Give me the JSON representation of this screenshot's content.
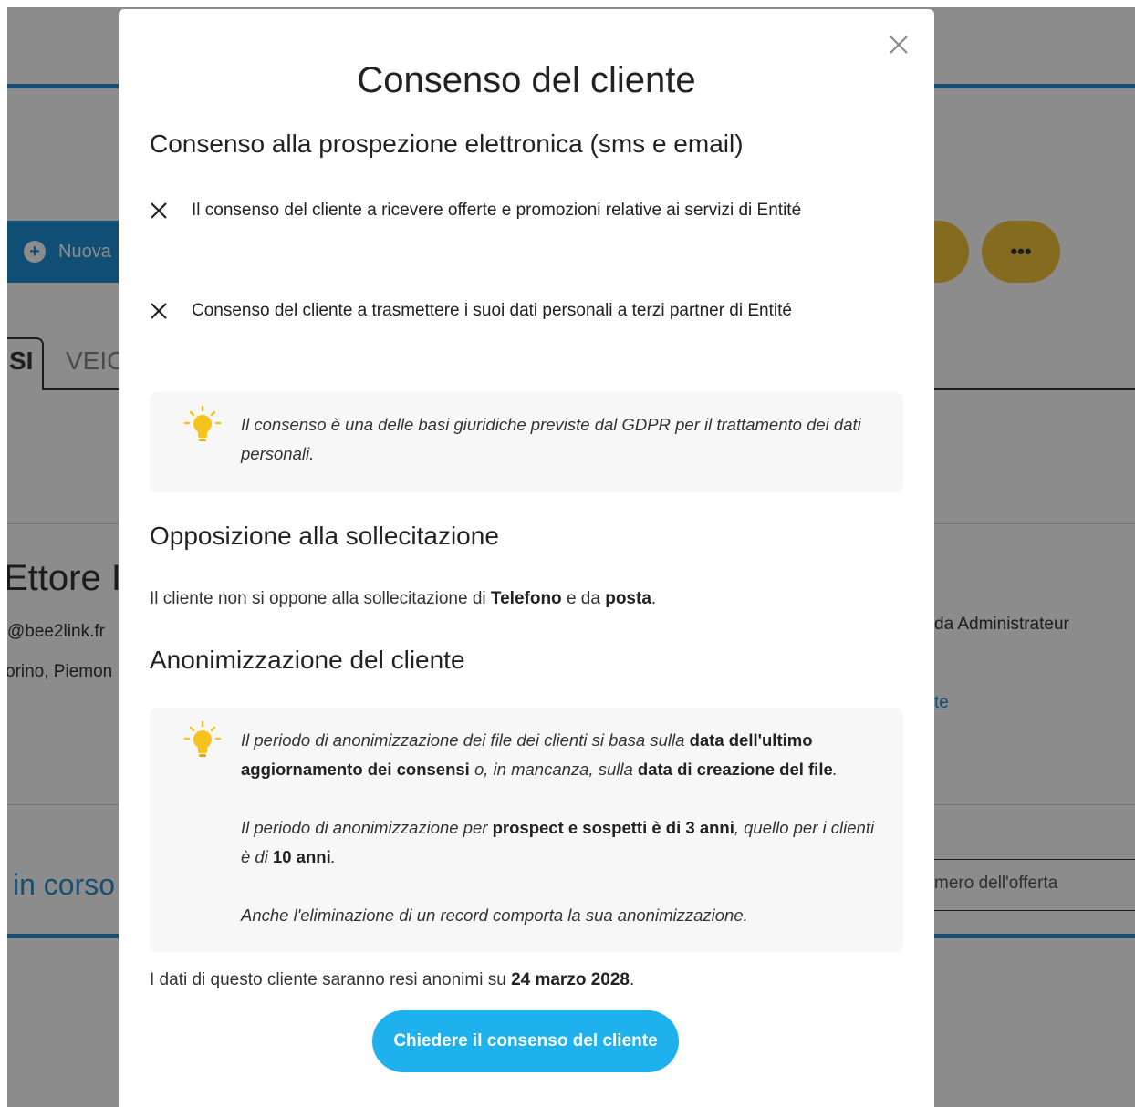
{
  "background": {
    "new_button_label": "Nuova",
    "more_button_label": "•••",
    "tab_label": "VEIC",
    "tab_active_label": "SI",
    "client_name": "Ettore I",
    "client_email": "@bee2link.fr",
    "client_location": "orino, Piemon",
    "status_text": "in corso",
    "right_admin_text": "da Administrateur",
    "right_link_text": "te",
    "right_offer_text": "mero dell'offerta"
  },
  "modal": {
    "title": "Consenso del cliente",
    "section_electronic": {
      "title": "Consenso alla prospezione elettronica (sms e email)",
      "items": [
        {
          "icon": "x-icon",
          "text": "Il consenso del cliente a ricevere offerte e promozioni relative ai servizi di Entité"
        },
        {
          "icon": "x-icon",
          "text": "Consenso del cliente a trasmettere i suoi dati personali a terzi partner di Entité"
        }
      ],
      "info": "Il consenso è una delle basi giuridiche previste dal GDPR per il trattamento dei dati personali."
    },
    "section_opposition": {
      "title": "Opposizione alla sollecitazione",
      "text_prefix": "Il cliente non si oppone alla sollecitazione di ",
      "channel_1": "Telefono",
      "text_middle": " e da ",
      "channel_2": "posta",
      "text_suffix": "."
    },
    "section_anonymization": {
      "title": "Anonimizzazione del cliente",
      "p1_a": "Il periodo di anonimizzazione dei file dei clienti si basa sulla ",
      "p1_b": "data dell'ultimo aggiornamento dei consensi",
      "p1_c": " o, in mancanza, sulla ",
      "p1_d": "data di creazione del file",
      "p1_e": ".",
      "p2_a": "Il periodo di anonimizzazione per ",
      "p2_b": "prospect e sospetti è di 3 anni",
      "p2_c": ", quello per i clienti è di ",
      "p2_d": "10 anni",
      "p2_e": ".",
      "p3": "Anche l'eliminazione di un record comporta la sua anonimizzazione."
    },
    "anonymize_date_prefix": "I dati di questo cliente saranno resi anonimi su ",
    "anonymize_date": "24 marzo 2028",
    "anonymize_date_suffix": ".",
    "primary_button_label": "Chiedere il consenso del cliente"
  },
  "colors": {
    "primary": "#1eb1ee",
    "app_blue": "#1f8fd6",
    "app_yellow": "#f2c33a",
    "bulb_yellow": "#f6c21c"
  }
}
